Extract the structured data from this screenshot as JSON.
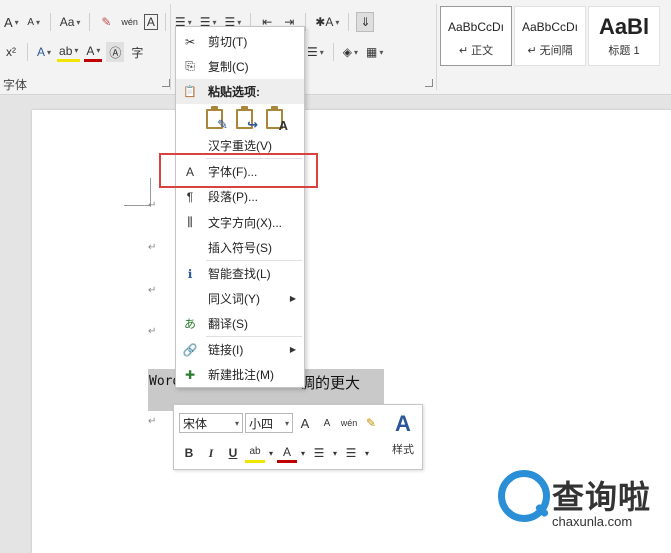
{
  "ribbon": {
    "row1": [
      "A",
      "A",
      "Aa",
      "✎",
      "wén",
      "A",
      "☰",
      "☰",
      "☰",
      "⇤",
      "⇥",
      "✱A",
      "⇓"
    ],
    "row2": [
      "x²",
      "A",
      "ab",
      "A",
      "Ⓐ",
      "字"
    ],
    "font_group_label": "字体",
    "para_group_label": "",
    "styles": [
      {
        "sample": "AaBbCcDı",
        "name": "↵ 正文"
      },
      {
        "sample": "AaBbCcDı",
        "name": "↵ 无间隔"
      },
      {
        "sample": "AaBl",
        "name": "标题 1"
      }
    ]
  },
  "context_menu": {
    "items": [
      {
        "icon": "✂",
        "label": "剪切(T)"
      },
      {
        "icon": "⎘",
        "label": "复制(C)"
      },
      {
        "icon": "📋",
        "label": "粘贴选项:"
      },
      {
        "icon": "",
        "label": "汉字重选(V)"
      },
      {
        "icon": "A",
        "label": "字体(F)..."
      },
      {
        "icon": "¶",
        "label": "段落(P)..."
      },
      {
        "icon": "⫼",
        "label": "文字方向(X)..."
      },
      {
        "icon": "",
        "label": "插入符号(S)"
      },
      {
        "icon": "ℹ",
        "label": "智能查找(L)"
      },
      {
        "icon": "",
        "label": "同义词(Y)"
      },
      {
        "icon": "あ",
        "label": "翻译(S)"
      },
      {
        "icon": "🔗",
        "label": "链接(I)"
      },
      {
        "icon": "✚",
        "label": "新建批注(M)"
      }
    ],
    "paste_glyphs": [
      "✎",
      "↪",
      "A"
    ]
  },
  "document": {
    "selected_text_left": "Word",
    "selected_text_right": "调的更大"
  },
  "mini_toolbar": {
    "font_name": "宋体",
    "font_size": "小四",
    "row1_buttons": [
      "A",
      "A",
      "wén",
      "✎"
    ],
    "row2_buttons": [
      "B",
      "I",
      "U",
      "ab",
      "A",
      "☰",
      "☰"
    ],
    "styles_label": "样式",
    "styles_glyph": "A"
  },
  "watermark": {
    "title": "查询啦",
    "url": "chaxunla.com"
  },
  "colors": {
    "highlight_border": "#d9433f",
    "accent": "#2b579a",
    "watermark_blue": "#2a8fd6"
  }
}
